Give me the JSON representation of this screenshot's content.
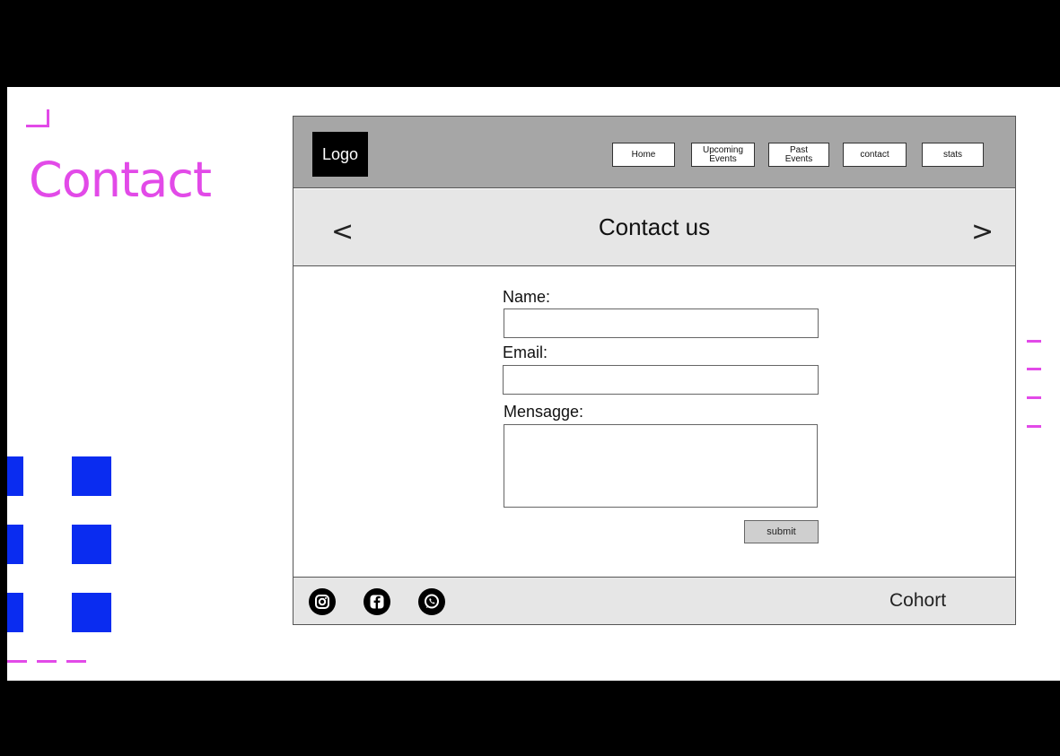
{
  "slide": {
    "title": "Contact",
    "accent_color": "#e24ae8",
    "decor_color": "#0a2cf0"
  },
  "wireframe": {
    "logo": "Logo",
    "nav": [
      {
        "label": "Home",
        "icon": ""
      },
      {
        "label": "Upcoming\nEvents",
        "icon": ""
      },
      {
        "label": "Past\nEvents",
        "icon": ""
      },
      {
        "label": "contact",
        "icon": ""
      },
      {
        "label": "stats",
        "icon": ""
      }
    ],
    "banner": {
      "title": "Contact us",
      "prev_icon": "<",
      "next_icon": ">"
    },
    "form": {
      "name_label": "Name:",
      "email_label": "Email:",
      "message_label": "Mensagge:",
      "submit_label": "submit"
    },
    "footer": {
      "social_icons": [
        "instagram-icon",
        "facebook-icon",
        "whatsapp-icon"
      ],
      "brand": "Cohort"
    }
  }
}
